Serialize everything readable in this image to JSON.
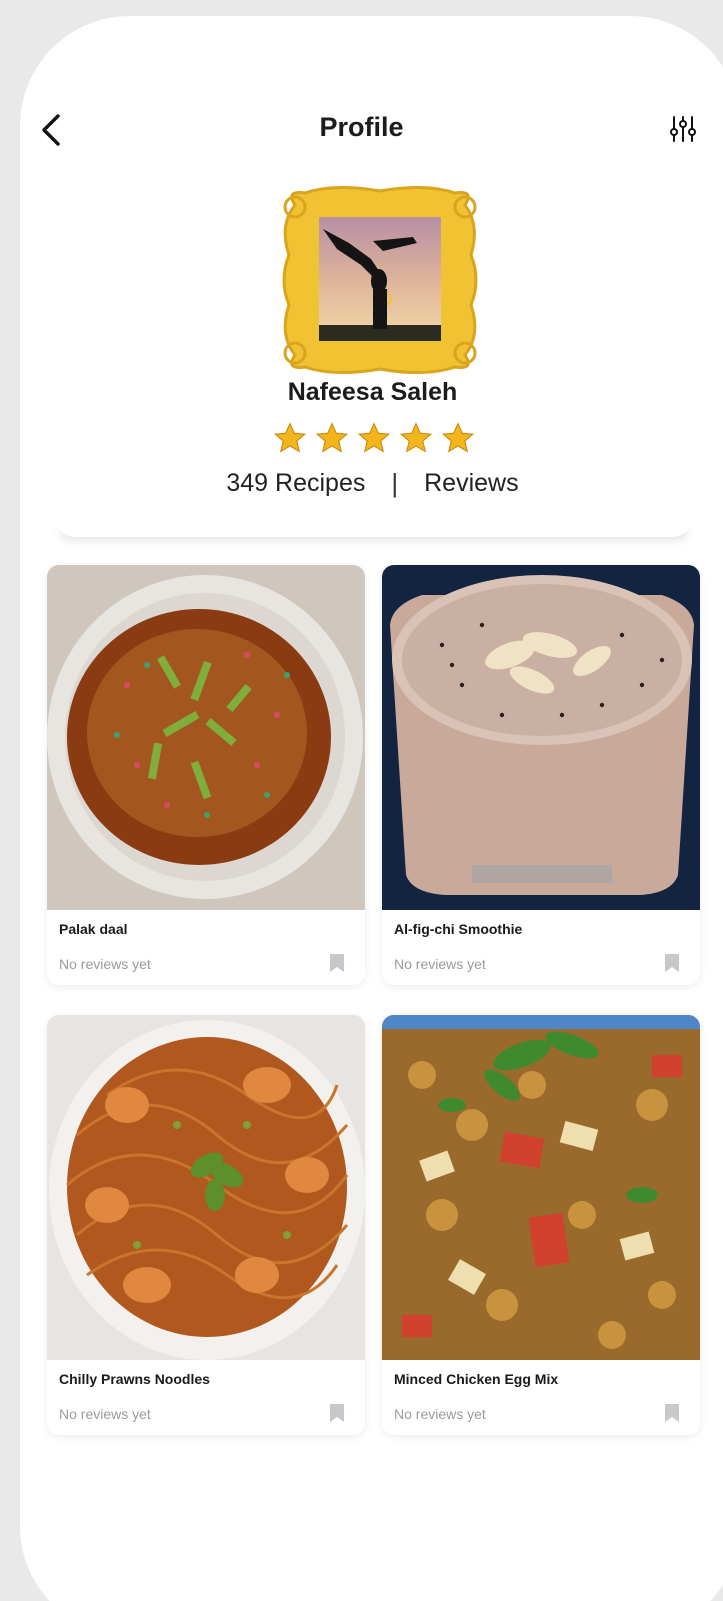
{
  "header": {
    "title": "Profile",
    "back_icon": "chevron-left-icon",
    "filter_icon": "sliders-icon"
  },
  "profile": {
    "name": "Nafeesa Saleh",
    "avatar_description": "yoga-handstand-silhouette-in-gold-frame",
    "rating_stars": 5,
    "recipes_label": "349 Recipes",
    "separator": "|",
    "reviews_label": "Reviews"
  },
  "recipes": [
    {
      "name": "Palak daal",
      "reviews": "No reviews yet"
    },
    {
      "name": "Al-fig-chi Smoothie",
      "reviews": "No reviews yet"
    },
    {
      "name": "Chilly Prawns Noodles",
      "reviews": "No reviews yet"
    },
    {
      "name": "Minced Chicken Egg Mix",
      "reviews": "No reviews yet"
    }
  ],
  "colors": {
    "star": "#f2b51c",
    "frame": "#f1c232",
    "bookmark": "#c8c8cc",
    "muted_text": "#9a9aa0"
  }
}
